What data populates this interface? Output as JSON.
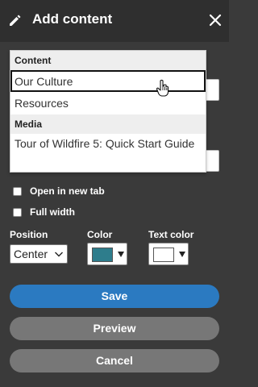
{
  "header": {
    "title": "Add content",
    "icons": {
      "edit": "pencil-icon",
      "close": "close-icon"
    }
  },
  "dropdown": {
    "groups": [
      {
        "label": "Content",
        "items": [
          "Our Culture",
          "Resources"
        ]
      },
      {
        "label": "Media",
        "items": [
          "Tour of Wildfire 5: Quick Start Guide"
        ]
      }
    ],
    "highlighted_item": "Our Culture"
  },
  "options": {
    "open_in_new_tab": {
      "label": "Open in new tab",
      "checked": false
    },
    "full_width": {
      "label": "Full width",
      "checked": false
    }
  },
  "fields": {
    "position": {
      "label": "Position",
      "value": "Center"
    },
    "color": {
      "label": "Color",
      "swatch": "#2e7d8c"
    },
    "text_color": {
      "label": "Text color",
      "swatch": "#ffffff"
    }
  },
  "buttons": {
    "save": "Save",
    "preview": "Preview",
    "cancel": "Cancel"
  },
  "colors": {
    "header_bg": "#2f2f2f",
    "panel_bg": "#3a3a3a",
    "primary": "#2b7ac1",
    "secondary": "#777777"
  }
}
